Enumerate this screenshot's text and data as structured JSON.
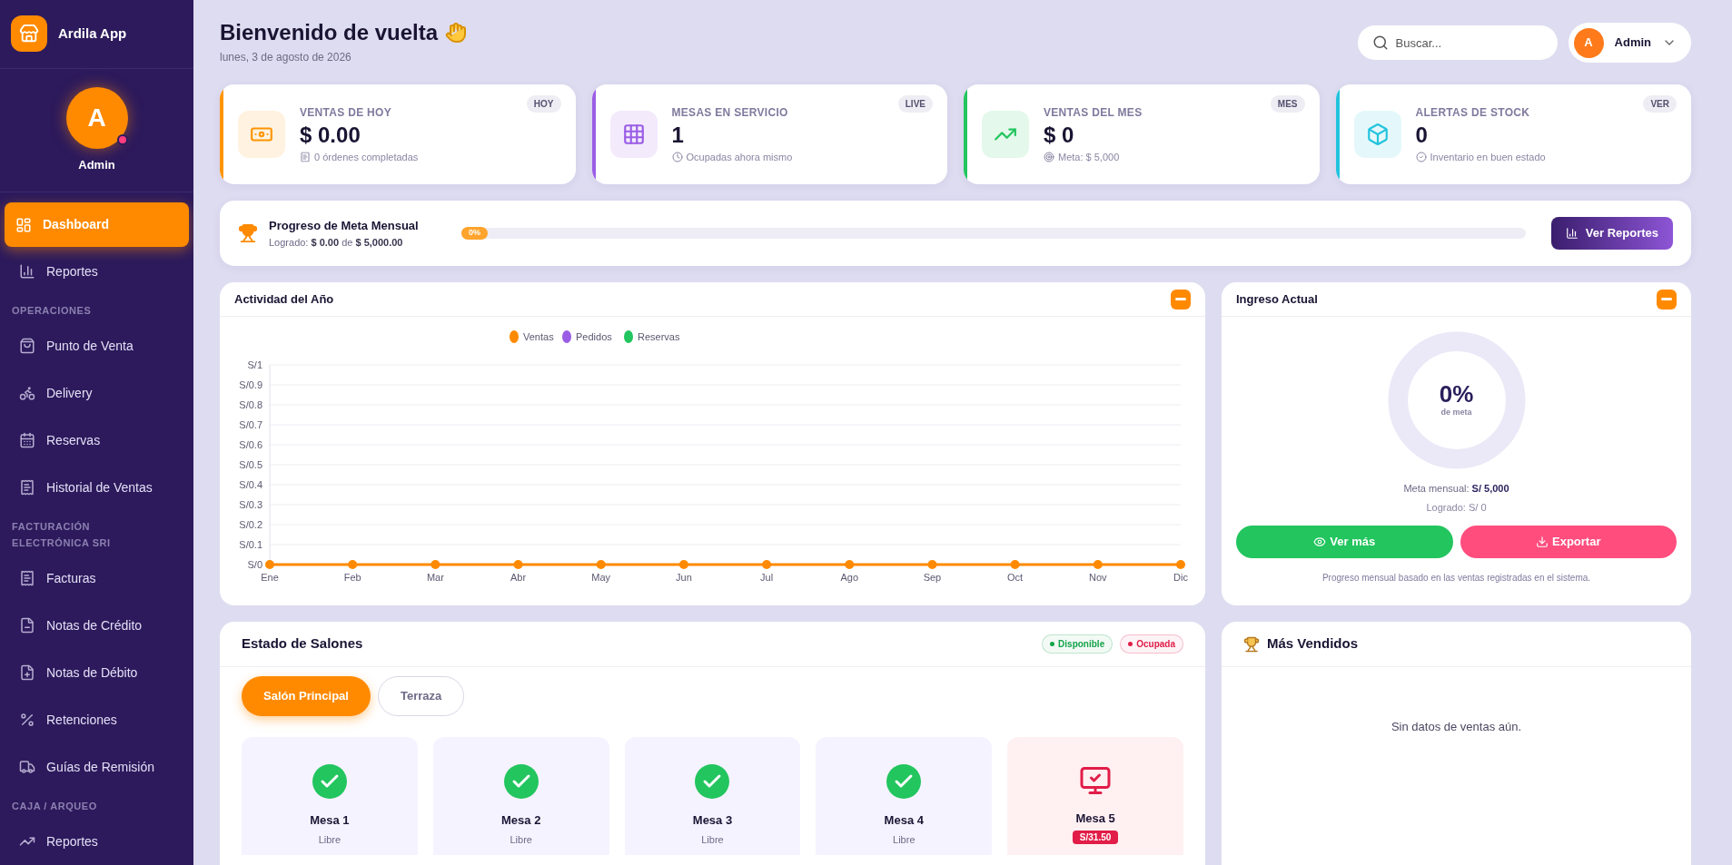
{
  "sidebar": {
    "app_name": "Ardila App",
    "user": {
      "initial": "A",
      "name": "Admin",
      "online": true
    },
    "groups": [
      {
        "items": [
          {
            "label": "Dashboard",
            "selected": true
          },
          {
            "label": "Reportes",
            "selected": false
          }
        ]
      },
      {
        "heading": "OPERACIONES",
        "items": [
          {
            "label": "Punto de Venta",
            "selected": false
          },
          {
            "label": "Delivery",
            "selected": false
          },
          {
            "label": "Reservas",
            "selected": false
          },
          {
            "label": "Historial de Ventas",
            "selected": false
          }
        ]
      },
      {
        "heading": "FACTURACIÓN ELECTRÓNICA SRI",
        "items": [
          {
            "label": "Facturas",
            "selected": false
          },
          {
            "label": "Notas de Crédito",
            "selected": false
          },
          {
            "label": "Notas de Débito",
            "selected": false
          },
          {
            "label": "Retenciones",
            "selected": false
          },
          {
            "label": "Guías de Remisión",
            "selected": false
          }
        ]
      },
      {
        "heading": "CAJA / ARQUEO",
        "items": [
          {
            "label": "Reportes",
            "selected": false
          }
        ]
      }
    ]
  },
  "header": {
    "title": "Bienvenido de vuelta",
    "date": "lunes, 3 de agosto de 2026",
    "search": {
      "placeholder": "Buscar..."
    },
    "user": {
      "initial": "A",
      "name": "Admin"
    }
  },
  "stats": [
    {
      "kind": "money",
      "label": "VENTAS DE HOY",
      "value": "$ 0.00",
      "note": "0 órdenes completadas",
      "badge": "HOY",
      "color": "#ff9500"
    },
    {
      "kind": "tables",
      "label": "MESAS EN SERVICIO",
      "value": "1",
      "note": "Ocupadas ahora mismo",
      "badge": "LIVE",
      "color": "#9b5de5"
    },
    {
      "kind": "trend",
      "label": "VENTAS DEL MES",
      "value": "$ 0",
      "note": "Meta: $ 5,000",
      "badge": "MES",
      "color": "#22c55e"
    },
    {
      "kind": "box",
      "label": "ALERTAS DE STOCK",
      "value": "0",
      "note": "Inventario en buen estado",
      "badge": "VER",
      "color": "#22c3dd"
    }
  ],
  "goal": {
    "title": "Progreso de Meta Mensual",
    "achieved_label": "Logrado:",
    "achieved": "$ 0.00",
    "of": "de",
    "target": "$ 5,000.00",
    "percent": "0%",
    "level": 0,
    "button": "Ver Reportes"
  },
  "activity": {
    "title": "Actividad del Año",
    "chart_data": {
      "type": "line",
      "grid": true,
      "legend": true,
      "categories": [
        "Ene",
        "Feb",
        "Mar",
        "Abr",
        "May",
        "Jun",
        "Jul",
        "Ago",
        "Sep",
        "Oct",
        "Nov",
        "Dic"
      ],
      "series": [
        {
          "name": "Ventas",
          "color": "#ff8a00",
          "marker": "circle",
          "values": [
            0,
            0,
            0,
            0,
            0,
            0,
            0,
            0,
            0,
            0,
            0,
            0
          ]
        },
        {
          "name": "Pedidos",
          "color": "#9b5de5",
          "values": [
            null,
            null,
            null,
            null,
            null,
            null,
            null,
            null,
            null,
            null,
            null,
            null
          ]
        },
        {
          "name": "Reservas",
          "color": "#22c55e",
          "values": [
            null,
            null,
            null,
            null,
            null,
            null,
            null,
            null,
            null,
            null,
            null,
            null
          ]
        }
      ],
      "ylim": [
        0,
        1
      ],
      "yticks": [
        {
          "value": 0,
          "label": "S/0"
        },
        {
          "value": 0.1,
          "label": "S/0.1"
        },
        {
          "value": 0.2,
          "label": "S/0.2"
        },
        {
          "value": 0.3,
          "label": "S/0.3"
        },
        {
          "value": 0.4,
          "label": "S/0.4"
        },
        {
          "value": 0.5,
          "label": "S/0.5"
        },
        {
          "value": 0.6,
          "label": "S/0.6"
        },
        {
          "value": 0.7,
          "label": "S/0.7"
        },
        {
          "value": 0.8,
          "label": "S/0.8"
        },
        {
          "value": 0.9,
          "label": "S/0.9"
        },
        {
          "value": 1,
          "label": "S/1"
        }
      ]
    }
  },
  "income": {
    "title": "Ingreso Actual",
    "percent": "0%",
    "percent_caption": "de meta",
    "level": 0,
    "goal_label": "Meta mensual:",
    "goal": "S/ 5,000",
    "achieved": "Logrado: S/ 0",
    "buttons": [
      {
        "kind": "view",
        "label": "Ver más"
      },
      {
        "kind": "export",
        "label": "Exportar"
      }
    ],
    "footnote": "Progreso mensual basado en las ventas registradas en el sistema."
  },
  "rooms": {
    "title": "Estado de Salones",
    "legend": [
      {
        "label": "Disponible",
        "color": "#16a34a"
      },
      {
        "label": "Ocupada",
        "color": "#e11d48"
      }
    ],
    "tabs": [
      {
        "label": "Salón Principal",
        "selected": true
      },
      {
        "label": "Terraza",
        "selected": false
      }
    ],
    "tables": [
      {
        "name": "Mesa 1",
        "kind": "libre",
        "status": "Libre"
      },
      {
        "name": "Mesa 2",
        "kind": "libre",
        "status": "Libre"
      },
      {
        "name": "Mesa 3",
        "kind": "libre",
        "status": "Libre"
      },
      {
        "name": "Mesa 4",
        "kind": "libre",
        "status": "Libre"
      },
      {
        "name": "Mesa 5",
        "kind": "ocupada",
        "status": "S/31.50"
      }
    ]
  },
  "best_sellers": {
    "title": "Más Vendidos",
    "empty": "Sin datos de ventas aún."
  }
}
